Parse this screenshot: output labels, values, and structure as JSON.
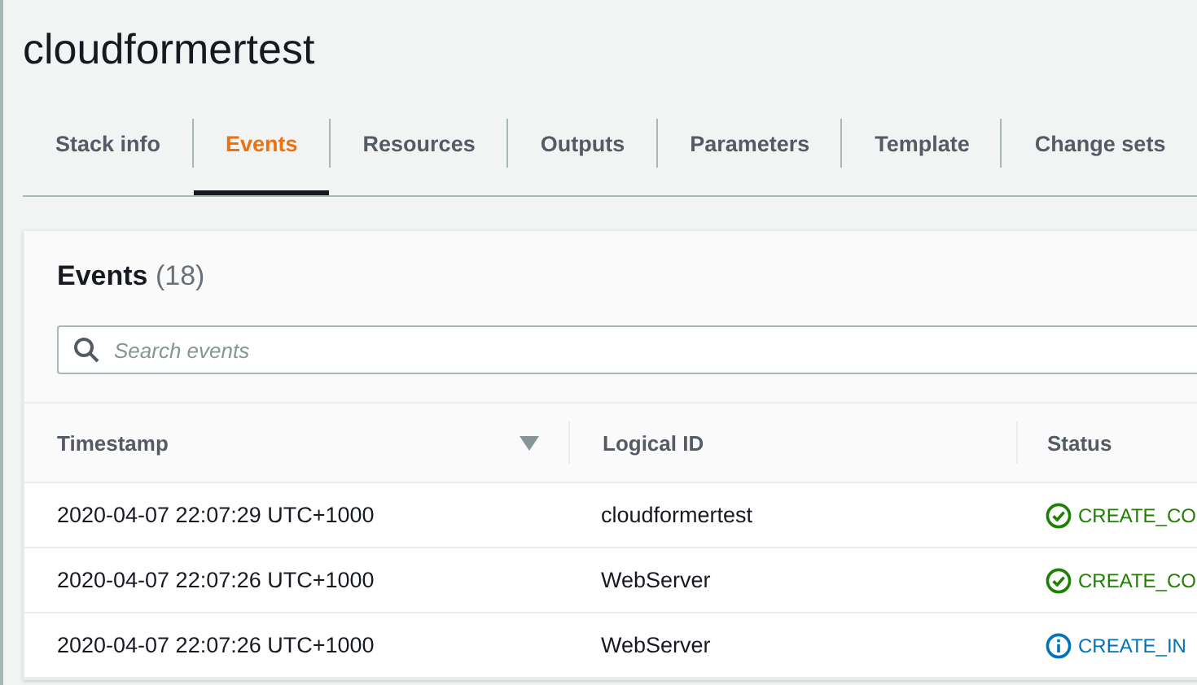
{
  "title": "cloudformertest",
  "tabs": [
    {
      "label": "Stack info",
      "selected": false
    },
    {
      "label": "Events",
      "selected": true
    },
    {
      "label": "Resources",
      "selected": false
    },
    {
      "label": "Outputs",
      "selected": false
    },
    {
      "label": "Parameters",
      "selected": false
    },
    {
      "label": "Template",
      "selected": false
    },
    {
      "label": "Change sets",
      "selected": false
    }
  ],
  "events": {
    "heading": "Events",
    "count": "(18)",
    "search": {
      "placeholder": "Search events"
    },
    "columns": [
      "Timestamp",
      "Logical ID",
      "Status"
    ],
    "rows": [
      {
        "timestamp": "2020-04-07 22:07:29 UTC+1000",
        "logical_id": "cloudformertest",
        "status": "CREATE_CO",
        "kind": "success"
      },
      {
        "timestamp": "2020-04-07 22:07:26 UTC+1000",
        "logical_id": "WebServer",
        "status": "CREATE_CO",
        "kind": "success"
      },
      {
        "timestamp": "2020-04-07 22:07:26 UTC+1000",
        "logical_id": "WebServer",
        "status": "CREATE_IN",
        "kind": "info"
      }
    ]
  }
}
